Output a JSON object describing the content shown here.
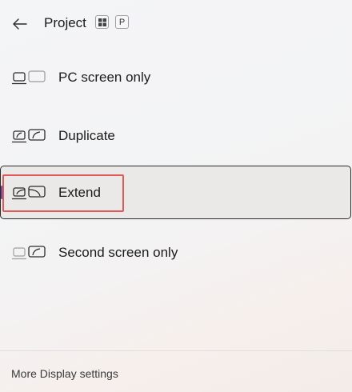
{
  "header": {
    "title": "Project",
    "key_windows_icon": "windows-logo-icon",
    "key_p": "P"
  },
  "options": [
    {
      "label": "PC screen only",
      "icon": "pc-screen-only-icon"
    },
    {
      "label": "Duplicate",
      "icon": "duplicate-icon"
    },
    {
      "label": "Extend",
      "icon": "extend-icon",
      "selected": true
    },
    {
      "label": "Second screen only",
      "icon": "second-screen-only-icon"
    }
  ],
  "footer": {
    "more_settings": "More Display settings"
  },
  "colors": {
    "accent": "#6b4ca0",
    "highlight_box": "#e05a5a",
    "selected_bg": "#ebe9e8"
  }
}
